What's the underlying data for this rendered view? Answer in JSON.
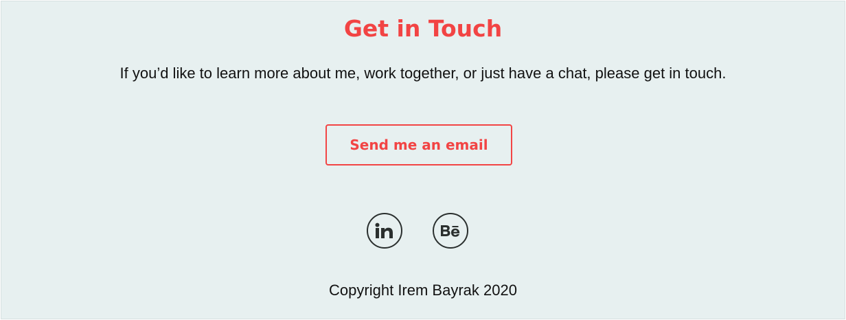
{
  "contact": {
    "title": "Get in Touch",
    "lead": "If you’d like to learn more about me, work together, or just have a chat, please get in touch.",
    "button_label": "Send me an email"
  },
  "social": {
    "linkedin_icon": "linkedin-icon",
    "behance_icon": "behance-icon"
  },
  "footer": {
    "copyright": "Copyright Irem Bayrak 2020"
  },
  "colors": {
    "accent": "#f24444",
    "background": "#e7f0f0",
    "icon": "#2a2f2e",
    "text": "#111111"
  }
}
